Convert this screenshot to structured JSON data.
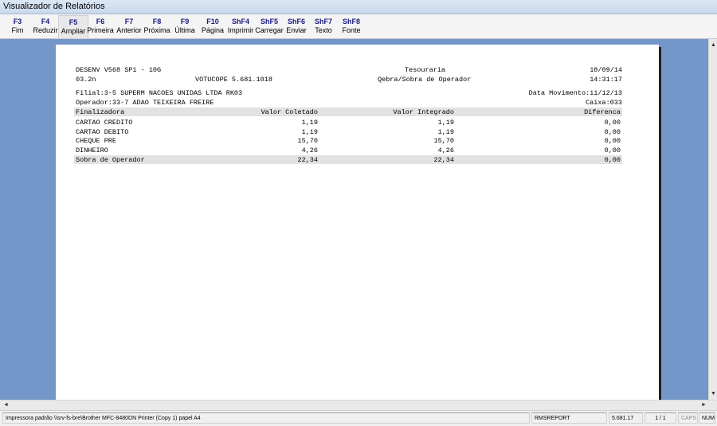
{
  "window": {
    "title": "Visualizador de Relatórios"
  },
  "toolbar": [
    {
      "key": "F3",
      "label": "Fim"
    },
    {
      "key": "F4",
      "label": "Reduzir"
    },
    {
      "key": "F5",
      "label": "Ampliar"
    },
    {
      "key": "F6",
      "label": "Primeira"
    },
    {
      "key": "F7",
      "label": "Anterior"
    },
    {
      "key": "F8",
      "label": "Próxima"
    },
    {
      "key": "F9",
      "label": "Última"
    },
    {
      "key": "F10",
      "label": "Página"
    },
    {
      "key": "ShF4",
      "label": "Imprimir"
    },
    {
      "key": "ShF5",
      "label": "Carregar"
    },
    {
      "key": "ShF6",
      "label": "Enviar"
    },
    {
      "key": "ShF7",
      "label": "Texto"
    },
    {
      "key": "ShF8",
      "label": "Fonte"
    }
  ],
  "report": {
    "system": "DESENV V568 SP1 - 10G",
    "department": "Tesouraria",
    "date": "18/09/14",
    "version": "03.2n",
    "company": "VOTUCOPE 5.681.1018",
    "report_title": "Qebra/Sobra de Operador",
    "time": "14:31:17",
    "filial": "Filial:3-5 SUPERM NACOES UNIDAS LTDA RK03",
    "data_movimento": "Data Movimento:11/12/13",
    "operador": "Operador:33-7 ADAO TEIXEIRA FREIRE",
    "caixa": "Caixa:033",
    "columns": [
      "Finalizadora",
      "Valor Coletado",
      "Valor Integrado",
      "Diferenca"
    ],
    "rows": [
      [
        "CARTAO CREDITO",
        "1,19",
        "1,19",
        "0,00"
      ],
      [
        "CARTAO DEBITO",
        "1,19",
        "1,19",
        "0,00"
      ],
      [
        "CHEQUE PRE",
        "15,70",
        "15,70",
        "0,00"
      ],
      [
        "DINHEIRO",
        "4,26",
        "4,26",
        "0,00"
      ]
    ],
    "total": [
      "Sobra de Operador",
      "22,34",
      "22,34",
      "0,00"
    ]
  },
  "status": {
    "printer": "Impressora padrão \\\\srv-fs-bre\\Brother MFC-8480DN Printer (Copy 1) papel A4",
    "module": "RMSREPORT",
    "version": "5.681.17",
    "page": "1 / 1",
    "caps": "CAPS",
    "num": "NUM"
  }
}
